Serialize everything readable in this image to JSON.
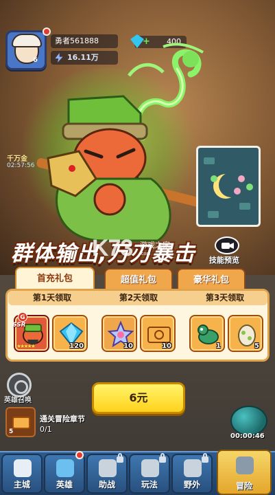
{
  "hud": {
    "player_name": "勇者561888",
    "power": "16.11万",
    "gems": "400",
    "level": "6",
    "side_label": "千万金",
    "side_timer": "02:57:56"
  },
  "banner": {
    "headline": "群体输出,万刃暴击",
    "watermark_logo": "K73",
    "watermark_site": "游戏之家",
    "watermark_url": ".com"
  },
  "skill_preview": {
    "label": "技能预览"
  },
  "tabs": [
    {
      "label": "首充礼包",
      "active": true
    },
    {
      "label": "超值礼包",
      "active": false
    },
    {
      "label": "豪华礼包",
      "active": false
    }
  ],
  "days": [
    {
      "label": "第1天领取",
      "items": [
        {
          "icon": "hero-card-icon",
          "badge": "G",
          "rarity": "SSR",
          "stars": "★★★★★",
          "qty": ""
        },
        {
          "icon": "diamond-icon",
          "qty": "120"
        }
      ]
    },
    {
      "label": "第2天领取",
      "items": [
        {
          "icon": "star-crystal-icon",
          "qty": "10"
        },
        {
          "icon": "ticket-icon",
          "qty": "10"
        }
      ]
    },
    {
      "label": "第3天领取",
      "items": [
        {
          "icon": "green-dragon-pet-icon",
          "qty": "1"
        },
        {
          "icon": "egg-icon",
          "qty": "5"
        }
      ]
    }
  ],
  "buy_button": {
    "label": "6元"
  },
  "left_widgets": {
    "summon_label": "英雄召唤",
    "quest_count": "5",
    "quest_text": "通关冒险章节",
    "quest_progress": "0/1"
  },
  "timer": "00:00:46",
  "nav": [
    {
      "label": "主城",
      "icon": "castle-icon",
      "locked": false,
      "active": false
    },
    {
      "label": "英雄",
      "icon": "hero-helmet-icon",
      "locked": false,
      "active": false
    },
    {
      "label": "助战",
      "icon": "fist-icon",
      "locked": true,
      "active": false
    },
    {
      "label": "玩法",
      "icon": "scroll-icon",
      "locked": true,
      "active": false
    },
    {
      "label": "野外",
      "icon": "portal-icon",
      "locked": true,
      "active": false
    },
    {
      "label": "冒险",
      "icon": "crossed-swords-icon",
      "locked": false,
      "active": true
    }
  ],
  "colors": {
    "accent_gold": "#ffd21c",
    "panel_bg": "#fff6e0",
    "nav_blue": "#2c5b8c",
    "tab_orange": "#f0a64a"
  }
}
